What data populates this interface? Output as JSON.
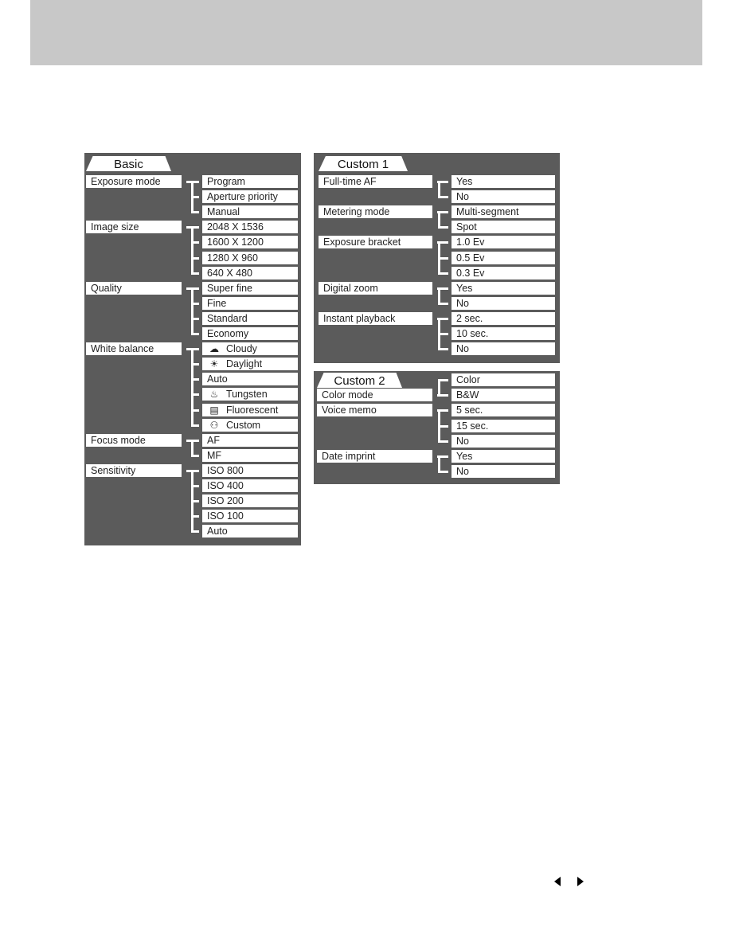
{
  "panels": [
    {
      "id": "basic",
      "title": "Basic",
      "groups": [
        {
          "label": "Exposure mode",
          "options": [
            {
              "text": "Program"
            },
            {
              "text": "Aperture priority"
            },
            {
              "text": "Manual"
            }
          ]
        },
        {
          "label": "Image size",
          "options": [
            {
              "text": "2048 X 1536"
            },
            {
              "text": "1600 X 1200"
            },
            {
              "text": "1280 X 960"
            },
            {
              "text": "640 X 480"
            }
          ]
        },
        {
          "label": "Quality",
          "options": [
            {
              "text": "Super fine"
            },
            {
              "text": "Fine"
            },
            {
              "text": "Standard"
            },
            {
              "text": "Economy"
            }
          ]
        },
        {
          "label": "White balance",
          "options": [
            {
              "text": "Cloudy",
              "icon": "cloud-icon"
            },
            {
              "text": "Daylight",
              "icon": "sun-icon"
            },
            {
              "text": "Auto"
            },
            {
              "text": "Tungsten",
              "icon": "tungsten-bulb-icon"
            },
            {
              "text": "Fluorescent",
              "icon": "fluorescent-lamp-icon"
            },
            {
              "text": "Custom",
              "icon": "custom-wb-icon"
            }
          ]
        },
        {
          "label": "Focus mode",
          "options": [
            {
              "text": "AF"
            },
            {
              "text": "MF"
            }
          ]
        },
        {
          "label": "Sensitivity",
          "options": [
            {
              "text": "ISO 800"
            },
            {
              "text": "ISO 400"
            },
            {
              "text": "ISO 200"
            },
            {
              "text": "ISO 100"
            },
            {
              "text": "Auto"
            }
          ]
        }
      ]
    },
    {
      "id": "custom1",
      "title": "Custom 1",
      "groups": [
        {
          "label": "Full-time AF",
          "options": [
            {
              "text": "Yes"
            },
            {
              "text": "No"
            }
          ]
        },
        {
          "label": "Metering mode",
          "options": [
            {
              "text": "Multi-segment"
            },
            {
              "text": "Spot"
            }
          ]
        },
        {
          "label": "Exposure bracket",
          "options": [
            {
              "text": "1.0 Ev"
            },
            {
              "text": "0.5 Ev"
            },
            {
              "text": "0.3 Ev"
            }
          ]
        },
        {
          "label": "Digital zoom",
          "options": [
            {
              "text": "Yes"
            },
            {
              "text": "No"
            }
          ]
        },
        {
          "label": "Instant playback",
          "options": [
            {
              "text": "2 sec."
            },
            {
              "text": "10 sec."
            },
            {
              "text": "No"
            }
          ]
        }
      ]
    },
    {
      "id": "custom2",
      "title": "Custom 2",
      "groups": [
        {
          "label": "Color mode",
          "options": [
            {
              "text": "Color"
            },
            {
              "text": "B&W"
            }
          ]
        },
        {
          "label": "Voice memo",
          "options": [
            {
              "text": "5 sec."
            },
            {
              "text": "15 sec."
            },
            {
              "text": "No"
            }
          ]
        },
        {
          "label": "Date imprint",
          "options": [
            {
              "text": "Yes"
            },
            {
              "text": "No"
            }
          ]
        }
      ]
    }
  ],
  "icons": {
    "cloud-icon": "☁",
    "sun-icon": "☀",
    "tungsten-bulb-icon": "♨",
    "fluorescent-lamp-icon": "▤",
    "custom-wb-icon": "⚇"
  },
  "navigation": {
    "prev_icon": "triangle-left-icon",
    "next_icon": "triangle-right-icon"
  },
  "colors": {
    "panel": "#5b5b5b",
    "header": "#c8c8c8"
  }
}
